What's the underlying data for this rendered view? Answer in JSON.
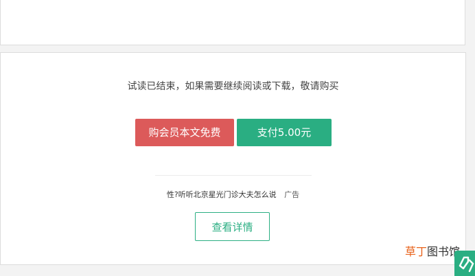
{
  "notice": {
    "text": "试读已结束，如果需要继续阅读或下载，敬请购买"
  },
  "buttons": {
    "member_label": "购会员本文免费",
    "pay_label": "支付5.00元",
    "detail_label": "查看详情"
  },
  "ad": {
    "title": "性?听听北京星光门诊大夫怎么说",
    "badge": "广告"
  },
  "watermark": {
    "part1": "草丁",
    "part2": "图书馆"
  },
  "colors": {
    "member_button": "#dc5a5a",
    "pay_button": "#2aae82",
    "detail_border": "#2aae82",
    "watermark_accent": "#e8621a"
  },
  "icons": {
    "corner_widget": "tag-icon"
  }
}
